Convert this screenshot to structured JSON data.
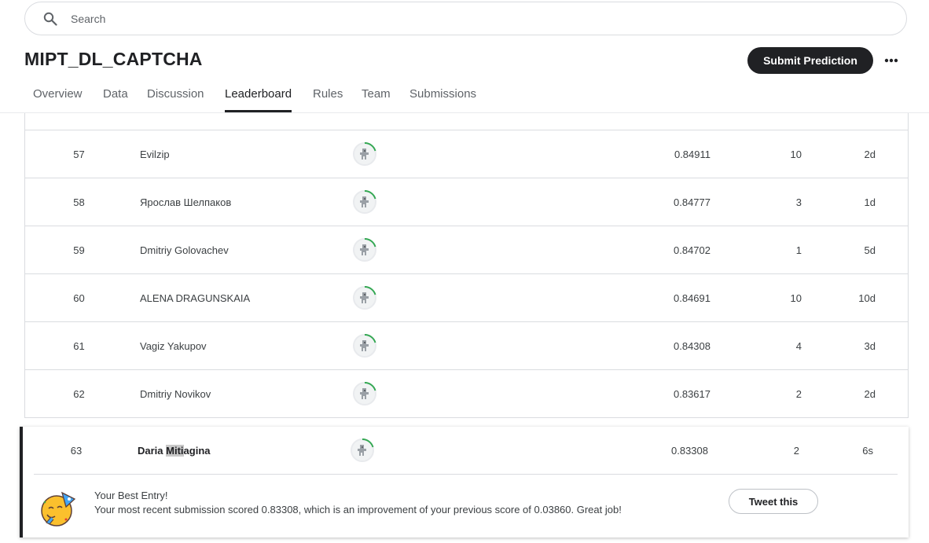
{
  "search": {
    "placeholder": "Search"
  },
  "competition": {
    "title": "MIPT_DL_CAPTCHA"
  },
  "header": {
    "submit_label": "Submit Prediction"
  },
  "tabs": [
    {
      "label": "Overview"
    },
    {
      "label": "Data"
    },
    {
      "label": "Discussion"
    },
    {
      "label": "Leaderboard",
      "active": true
    },
    {
      "label": "Rules"
    },
    {
      "label": "Team"
    },
    {
      "label": "Submissions"
    }
  ],
  "leaderboard": {
    "rows": [
      {
        "rank": "57",
        "name": "Evilzip",
        "score": "0.84911",
        "entries": "10",
        "last": "2d"
      },
      {
        "rank": "58",
        "name": "Ярослав Шелпаков",
        "score": "0.84777",
        "entries": "3",
        "last": "1d"
      },
      {
        "rank": "59",
        "name": "Dmitriy Golovachev",
        "score": "0.84702",
        "entries": "1",
        "last": "5d"
      },
      {
        "rank": "60",
        "name": "ALENA DRAGUNSKAIA",
        "score": "0.84691",
        "entries": "10",
        "last": "10d"
      },
      {
        "rank": "61",
        "name": "Vagiz Yakupov",
        "score": "0.84308",
        "entries": "4",
        "last": "3d"
      },
      {
        "rank": "62",
        "name": "Dmitriy Novikov",
        "score": "0.83617",
        "entries": "2",
        "last": "2d"
      }
    ],
    "my_entry": {
      "rank": "63",
      "name_part1": "Daria ",
      "name_highlight": "Miti",
      "name_part2": "agina",
      "score": "0.83308",
      "entries": "2",
      "last": "6s"
    }
  },
  "best_entry": {
    "title": "Your Best Entry!",
    "message": "Your most recent submission scored 0.83308, which is an improvement of your previous score of 0.03860. Great job!",
    "tweet_label": "Tweet this"
  },
  "colors": {
    "accent_dark": "#202124",
    "tier_ring": "#34a853"
  },
  "icons": {
    "search": "search-icon",
    "more": "more-horizontal-icon",
    "avatar": "user-avatar-icon",
    "celebration": "party-face-icon"
  }
}
